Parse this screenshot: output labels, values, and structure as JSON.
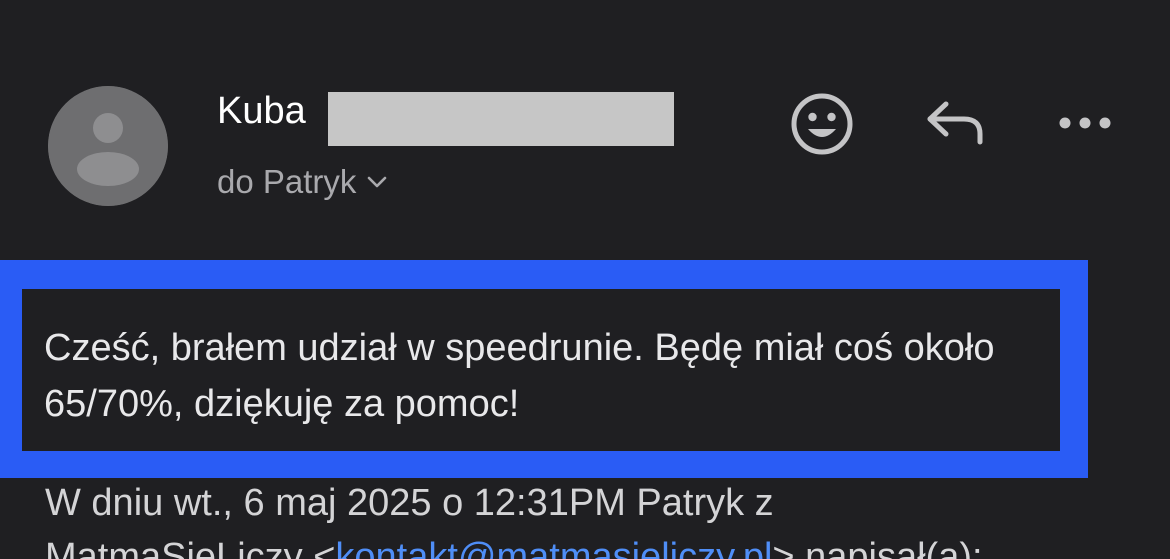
{
  "header": {
    "sender_name": "Kuba",
    "recipient_label": "do Patryk",
    "icons": {
      "avatar": "person-avatar-icon",
      "emoji": "smiley-icon",
      "reply": "reply-arrow-icon",
      "more": "more-dots-icon",
      "expand": "chevron-down-icon"
    }
  },
  "message": {
    "body": "Cześć, brałem udział w speedrunie. Będę miał coś około 65/70%, dziękuję za pomoc!"
  },
  "quote": {
    "line1": "W dniu wt., 6 maj 2025 o 12:31PM Patryk z",
    "line2_prefix": "MatmaSieLiczy <",
    "line2_link": "kontakt@matmasieliczy.pl",
    "line2_suffix": "> napisał(a):"
  },
  "colors": {
    "background": "#1f1f22",
    "highlight": "#2a5cf5",
    "link": "#4f8ef7",
    "muted_text": "#a9a9ad"
  }
}
